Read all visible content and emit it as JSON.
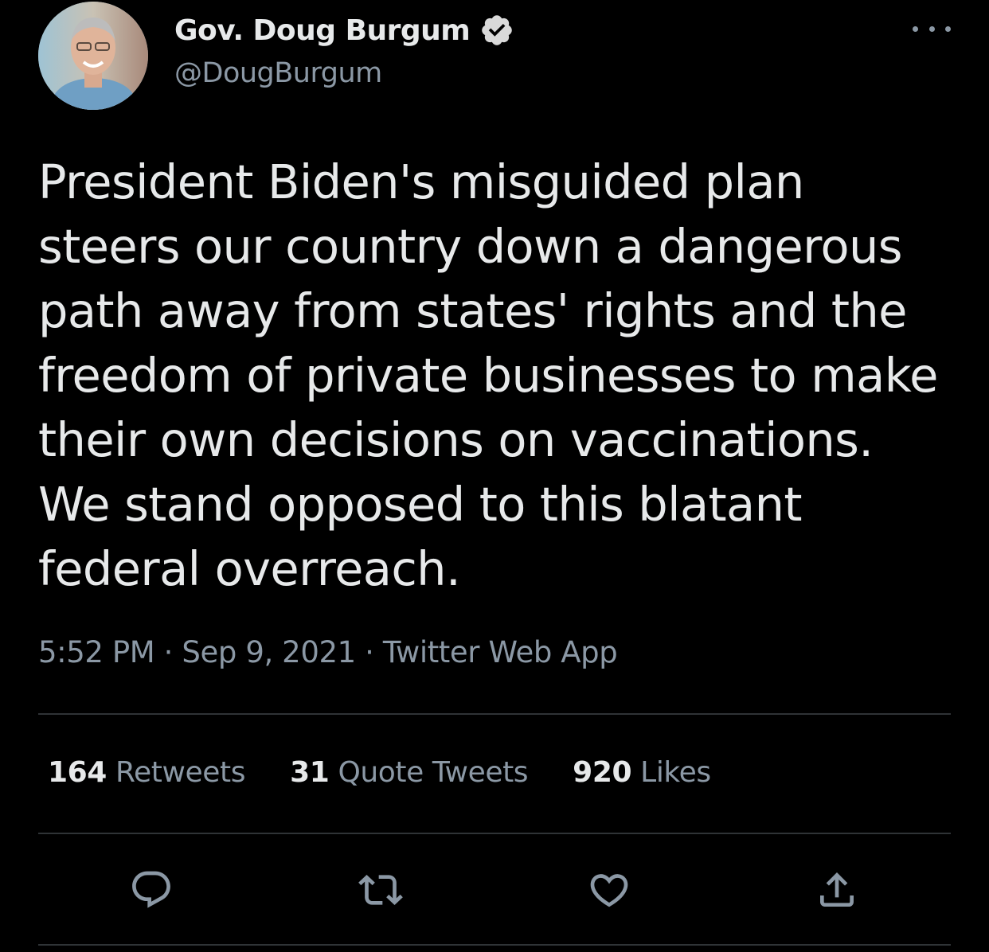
{
  "author": {
    "display_name": "Gov. Doug Burgum",
    "handle": "@DougBurgum",
    "verified": true
  },
  "tweet": {
    "text_lines": [
      "President Biden's misguided plan",
      "steers our country down a dangerous",
      "path away from states' rights and the",
      "freedom of private businesses to make",
      "their own decisions on vaccinations.",
      "We stand opposed to this blatant",
      "federal overreach."
    ],
    "time": "5:52 PM",
    "separator": "·",
    "date": "Sep 9, 2021",
    "source": "Twitter Web App"
  },
  "stats": {
    "retweets": {
      "count": "164",
      "label": "Retweets"
    },
    "quote_tweets": {
      "count": "31",
      "label": "Quote Tweets"
    },
    "likes": {
      "count": "920",
      "label": "Likes"
    }
  },
  "icons": {
    "verified": "verified-badge-icon",
    "more": "more-options-icon",
    "reply": "reply-icon",
    "retweet": "retweet-icon",
    "like": "like-heart-icon",
    "share": "share-icon"
  },
  "colors": {
    "background": "#000000",
    "primary_text": "#e7e9ea",
    "secondary_text": "#8b98a5",
    "divider": "#2f3336"
  }
}
